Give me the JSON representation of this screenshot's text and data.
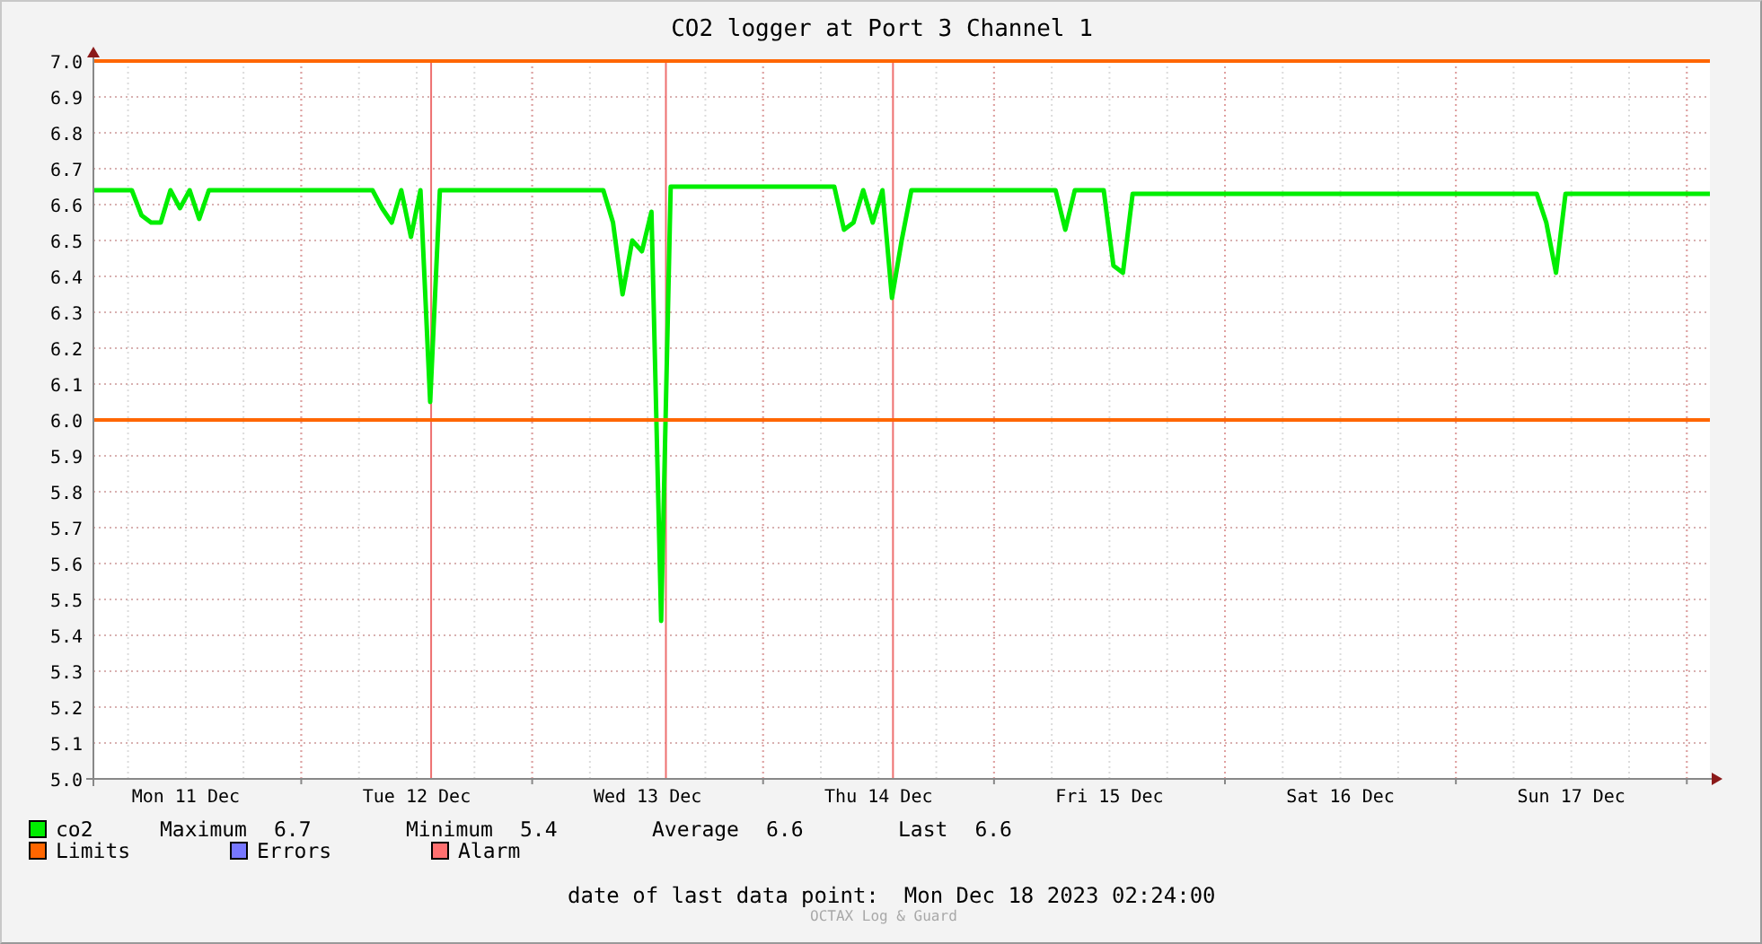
{
  "chart": {
    "title": "CO2 logger at Port 3 Channel 1",
    "chart_data": {
      "type": "line",
      "grid": true,
      "ylim": [
        5.0,
        7.0
      ],
      "categories": [
        null,
        null,
        null,
        null,
        null,
        null,
        null,
        null,
        null,
        null,
        "Mon 11 Dec",
        null,
        null,
        null,
        null,
        null,
        null,
        null,
        null,
        null,
        null,
        null,
        null,
        null,
        null,
        null,
        null,
        null,
        null,
        null,
        null,
        null,
        null,
        null,
        "Tue 12 Dec",
        null,
        null,
        null,
        null,
        null,
        null,
        null,
        null,
        null,
        null,
        null,
        null,
        null,
        null,
        null,
        null,
        null,
        null,
        null,
        null,
        null,
        null,
        null,
        "Wed 13 Dec",
        null,
        null,
        null,
        null,
        null,
        null,
        null,
        null,
        null,
        null,
        null,
        null,
        null,
        null,
        null,
        null,
        null,
        null,
        null,
        null,
        null,
        null,
        null,
        "Thu 14 Dec",
        null,
        null,
        null,
        null,
        null,
        null,
        null,
        null,
        null,
        null,
        null,
        null,
        null,
        null,
        null,
        null,
        null,
        null,
        null,
        null,
        null,
        null,
        null,
        "Fri 15 Dec",
        null,
        null,
        null,
        null,
        null,
        null,
        null,
        null,
        null,
        null,
        null,
        null,
        null,
        null,
        null,
        null,
        null,
        null,
        null,
        null,
        null,
        null,
        null,
        "Sat 16 Dec",
        null,
        null,
        null,
        null,
        null,
        null,
        null,
        null,
        null,
        null,
        null,
        null,
        null,
        null,
        null,
        null,
        null,
        null,
        null,
        null,
        null,
        null,
        null,
        "Sun 17 Dec",
        null,
        null,
        null,
        null,
        null,
        null,
        null,
        null,
        null,
        null,
        null,
        null,
        null,
        null
      ],
      "yticks": [
        {
          "value": 5.0,
          "label": "5.0"
        },
        {
          "value": 5.1,
          "label": "5.1"
        },
        {
          "value": 5.2,
          "label": "5.2"
        },
        {
          "value": 5.3,
          "label": "5.3"
        },
        {
          "value": 5.4,
          "label": "5.4"
        },
        {
          "value": 5.5,
          "label": "5.5"
        },
        {
          "value": 5.6,
          "label": "5.6"
        },
        {
          "value": 5.7,
          "label": "5.7"
        },
        {
          "value": 5.8,
          "label": "5.8"
        },
        {
          "value": 5.9,
          "label": "5.9"
        },
        {
          "value": 6.0,
          "label": "6.0"
        },
        {
          "value": 6.1,
          "label": "6.1"
        },
        {
          "value": 6.2,
          "label": "6.2"
        },
        {
          "value": 6.3,
          "label": "6.3"
        },
        {
          "value": 6.4,
          "label": "6.4"
        },
        {
          "value": 6.5,
          "label": "6.5"
        },
        {
          "value": 6.6,
          "label": "6.6"
        },
        {
          "value": 6.7,
          "label": "6.7"
        },
        {
          "value": 6.8,
          "label": "6.8"
        },
        {
          "value": 6.9,
          "label": "6.9"
        },
        {
          "value": 7.0,
          "label": "7.0"
        }
      ],
      "series": [
        {
          "name": "co2",
          "color": "#00ee00",
          "values": [
            6.64,
            6.64,
            6.64,
            6.64,
            6.64,
            6.57,
            6.55,
            6.55,
            6.64,
            6.59,
            6.64,
            6.56,
            6.64,
            6.64,
            6.64,
            6.64,
            6.64,
            6.64,
            6.64,
            6.64,
            6.64,
            6.64,
            6.64,
            6.64,
            6.64,
            6.64,
            6.64,
            6.64,
            6.64,
            6.64,
            6.59,
            6.55,
            6.64,
            6.51,
            6.64,
            6.05,
            6.64,
            6.64,
            6.64,
            6.64,
            6.64,
            6.64,
            6.64,
            6.64,
            6.64,
            6.64,
            6.64,
            6.64,
            6.64,
            6.64,
            6.64,
            6.64,
            6.64,
            6.64,
            6.55,
            6.35,
            6.5,
            6.47,
            6.58,
            5.44,
            6.65,
            6.65,
            6.65,
            6.65,
            6.65,
            6.65,
            6.65,
            6.65,
            6.65,
            6.65,
            6.65,
            6.65,
            6.65,
            6.65,
            6.65,
            6.65,
            6.65,
            6.65,
            6.53,
            6.55,
            6.64,
            6.55,
            6.64,
            6.34,
            6.5,
            6.64,
            6.64,
            6.64,
            6.64,
            6.64,
            6.64,
            6.64,
            6.64,
            6.64,
            6.64,
            6.64,
            6.64,
            6.64,
            6.64,
            6.64,
            6.64,
            6.53,
            6.64,
            6.64,
            6.64,
            6.64,
            6.43,
            6.41,
            6.63,
            6.63,
            6.63,
            6.63,
            6.63,
            6.63,
            6.63,
            6.63,
            6.63,
            6.63,
            6.63,
            6.63,
            6.63,
            6.63,
            6.63,
            6.63,
            6.63,
            6.63,
            6.63,
            6.63,
            6.63,
            6.63,
            6.63,
            6.63,
            6.63,
            6.63,
            6.63,
            6.63,
            6.63,
            6.63,
            6.63,
            6.63,
            6.63,
            6.63,
            6.63,
            6.63,
            6.63,
            6.63,
            6.63,
            6.63,
            6.63,
            6.63,
            6.63,
            6.55,
            6.41,
            6.63,
            6.63,
            6.63,
            6.63,
            6.63,
            6.63,
            6.63,
            6.63,
            6.63,
            6.63,
            6.63,
            6.63,
            6.63,
            6.63,
            6.63,
            6.63
          ]
        }
      ],
      "ref_lines": [
        {
          "axis": "y",
          "value": 7.0,
          "color": "#ff6600"
        },
        {
          "axis": "y",
          "value": 6.0,
          "color": "#ff6600"
        }
      ]
    }
  },
  "legend": {
    "stats": [
      {
        "label": "Maximum",
        "value": "6.7"
      },
      {
        "label": "Minimum",
        "value": "5.4"
      },
      {
        "label": "Average",
        "value": "6.6"
      },
      {
        "label": "Last",
        "value": "6.6"
      }
    ],
    "items": [
      {
        "label": "Limits",
        "color": "#ff6600"
      },
      {
        "label": "Errors",
        "color": "#7777ff"
      },
      {
        "label": "Alarm",
        "color": "#ff7070"
      }
    ]
  },
  "last_data_point": {
    "label": "date of last data point:",
    "value": "Mon Dec 18 2023 02:24:00"
  },
  "credit": "OCTAX Log & Guard"
}
